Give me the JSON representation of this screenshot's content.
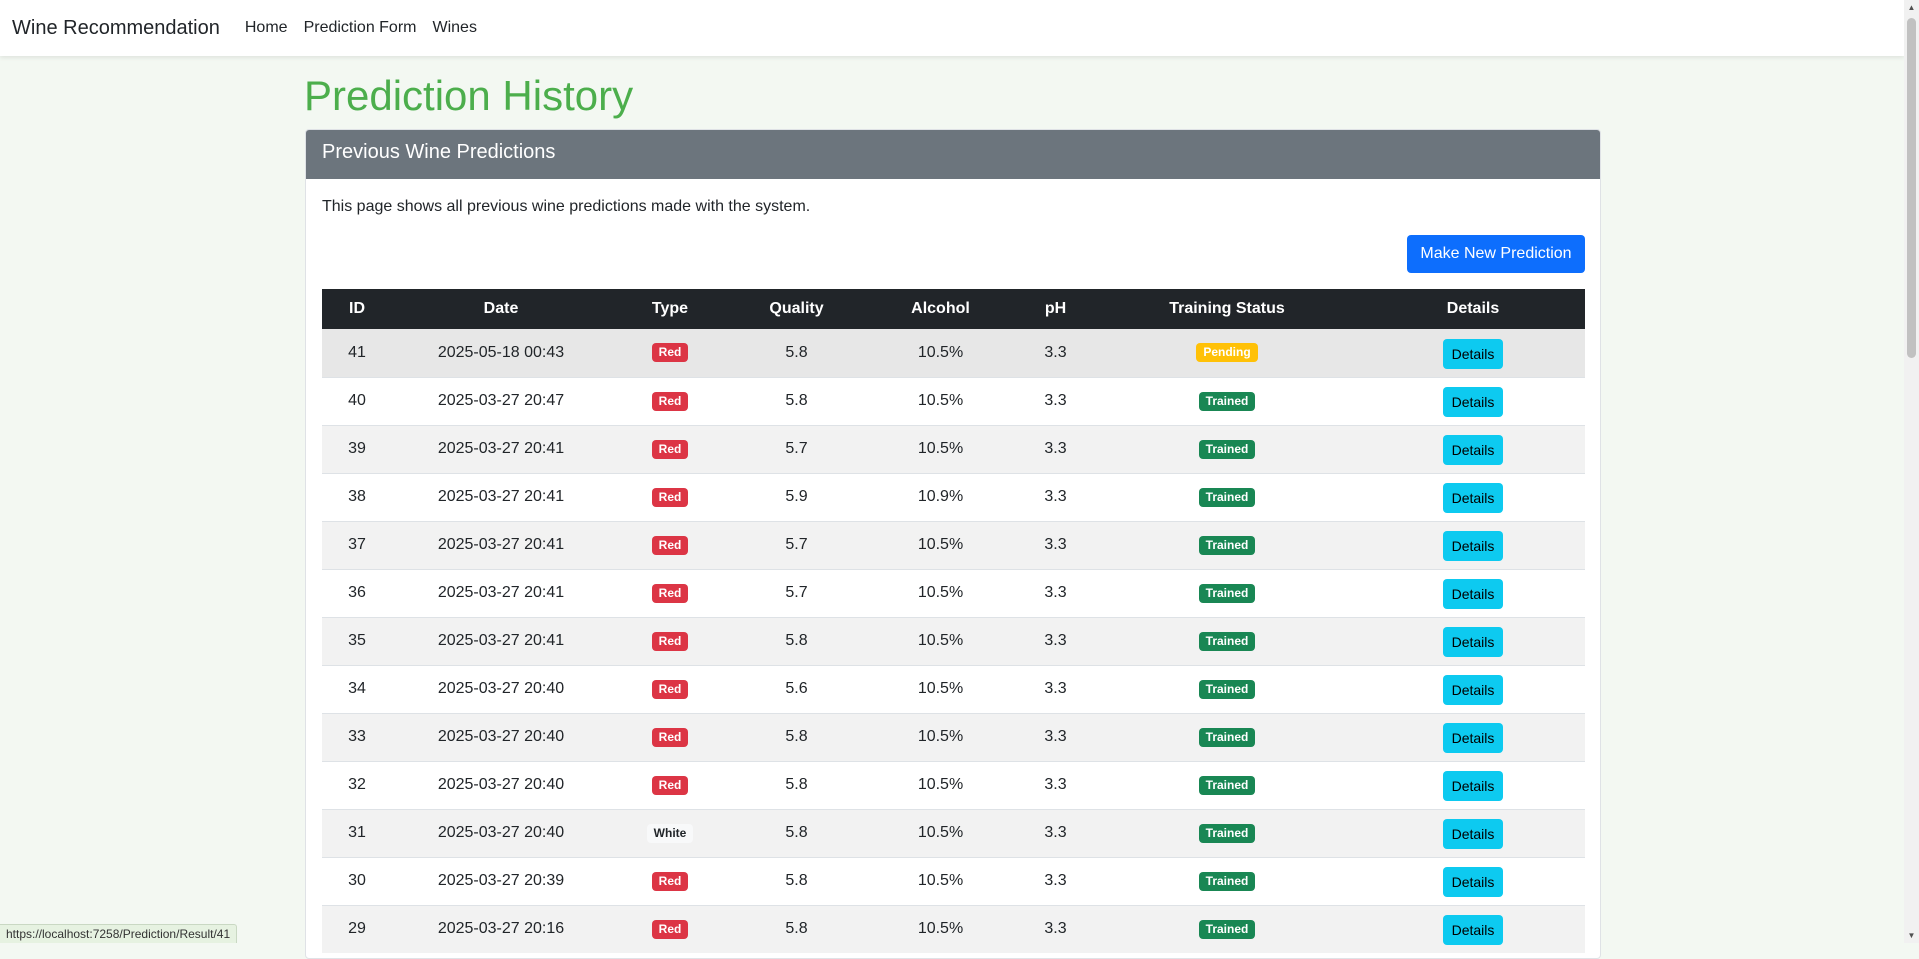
{
  "nav": {
    "brand": "Wine Recommendation",
    "links": [
      "Home",
      "Prediction Form",
      "Wines"
    ]
  },
  "page": {
    "title": "Prediction History",
    "card_title": "Previous Wine Predictions",
    "description": "This page shows all previous wine predictions made with the system.",
    "new_button": "Make New Prediction"
  },
  "table": {
    "headers": [
      "ID",
      "Date",
      "Type",
      "Quality",
      "Alcohol",
      "pH",
      "Training Status",
      "Details"
    ],
    "rows": [
      {
        "id": "41",
        "date": "2025-05-18 00:43",
        "type": "Red",
        "quality": "5.8",
        "alcohol": "10.5%",
        "ph": "3.3",
        "status": "Pending",
        "details": "Details"
      },
      {
        "id": "40",
        "date": "2025-03-27 20:47",
        "type": "Red",
        "quality": "5.8",
        "alcohol": "10.5%",
        "ph": "3.3",
        "status": "Trained",
        "details": "Details"
      },
      {
        "id": "39",
        "date": "2025-03-27 20:41",
        "type": "Red",
        "quality": "5.7",
        "alcohol": "10.5%",
        "ph": "3.3",
        "status": "Trained",
        "details": "Details"
      },
      {
        "id": "38",
        "date": "2025-03-27 20:41",
        "type": "Red",
        "quality": "5.9",
        "alcohol": "10.9%",
        "ph": "3.3",
        "status": "Trained",
        "details": "Details"
      },
      {
        "id": "37",
        "date": "2025-03-27 20:41",
        "type": "Red",
        "quality": "5.7",
        "alcohol": "10.5%",
        "ph": "3.3",
        "status": "Trained",
        "details": "Details"
      },
      {
        "id": "36",
        "date": "2025-03-27 20:41",
        "type": "Red",
        "quality": "5.7",
        "alcohol": "10.5%",
        "ph": "3.3",
        "status": "Trained",
        "details": "Details"
      },
      {
        "id": "35",
        "date": "2025-03-27 20:41",
        "type": "Red",
        "quality": "5.8",
        "alcohol": "10.5%",
        "ph": "3.3",
        "status": "Trained",
        "details": "Details"
      },
      {
        "id": "34",
        "date": "2025-03-27 20:40",
        "type": "Red",
        "quality": "5.6",
        "alcohol": "10.5%",
        "ph": "3.3",
        "status": "Trained",
        "details": "Details"
      },
      {
        "id": "33",
        "date": "2025-03-27 20:40",
        "type": "Red",
        "quality": "5.8",
        "alcohol": "10.5%",
        "ph": "3.3",
        "status": "Trained",
        "details": "Details"
      },
      {
        "id": "32",
        "date": "2025-03-27 20:40",
        "type": "Red",
        "quality": "5.8",
        "alcohol": "10.5%",
        "ph": "3.3",
        "status": "Trained",
        "details": "Details"
      },
      {
        "id": "31",
        "date": "2025-03-27 20:40",
        "type": "White",
        "quality": "5.8",
        "alcohol": "10.5%",
        "ph": "3.3",
        "status": "Trained",
        "details": "Details"
      },
      {
        "id": "30",
        "date": "2025-03-27 20:39",
        "type": "Red",
        "quality": "5.8",
        "alcohol": "10.5%",
        "ph": "3.3",
        "status": "Trained",
        "details": "Details"
      },
      {
        "id": "29",
        "date": "2025-03-27 20:16",
        "type": "Red",
        "quality": "5.8",
        "alcohol": "10.5%",
        "ph": "3.3",
        "status": "Trained",
        "details": "Details"
      }
    ]
  },
  "status_bar": {
    "url": "https://localhost:7258/Prediction/Result/41"
  },
  "colors": {
    "title_green": "#4cae4c",
    "card_header": "#6c757d",
    "primary": "#0d6efd",
    "info": "#0dcaf0",
    "danger": "#dc3545",
    "warning": "#ffc107",
    "success": "#198754"
  }
}
